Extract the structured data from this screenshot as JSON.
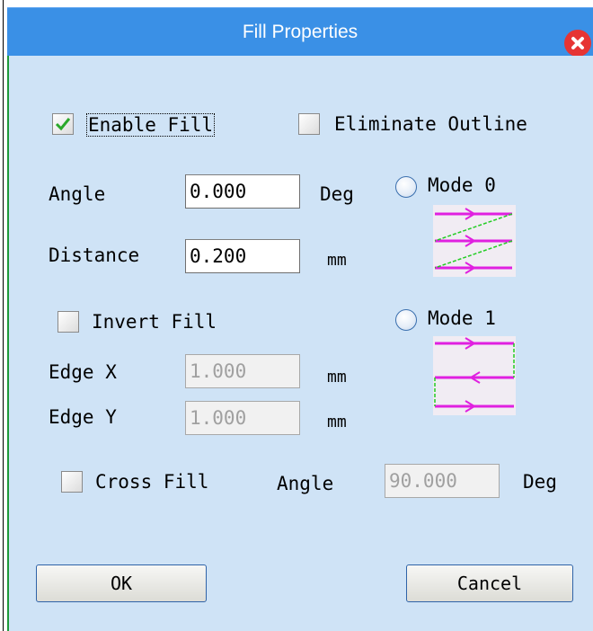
{
  "window": {
    "title": "Fill Properties"
  },
  "enable_fill": {
    "label": "Enable Fill",
    "checked": true
  },
  "eliminate_outline": {
    "label": "Eliminate Outline",
    "checked": false
  },
  "angle": {
    "label": "Angle",
    "value": "0.000",
    "unit": "Deg"
  },
  "distance": {
    "label": "Distance",
    "value": "0.200",
    "unit": "mm"
  },
  "invert_fill": {
    "label": "Invert Fill",
    "checked": false
  },
  "edge_x": {
    "label": "Edge X",
    "value": "1.000",
    "unit": "mm",
    "enabled": false
  },
  "edge_y": {
    "label": "Edge Y",
    "value": "1.000",
    "unit": "mm",
    "enabled": false
  },
  "cross_fill": {
    "label": "Cross Fill",
    "checked": false
  },
  "cross_angle": {
    "label": "Angle",
    "value": "90.000",
    "unit": "Deg",
    "enabled": false
  },
  "mode0": {
    "label": "Mode 0",
    "selected": false
  },
  "mode1": {
    "label": "Mode 1",
    "selected": false
  },
  "buttons": {
    "ok": "OK",
    "cancel": "Cancel"
  },
  "colors": {
    "title_bar": "#3a90e6",
    "client": "#cfe3f6",
    "fill_lines": "#e020e0",
    "connector_lines": "#22cc22",
    "close": "#e63434"
  }
}
